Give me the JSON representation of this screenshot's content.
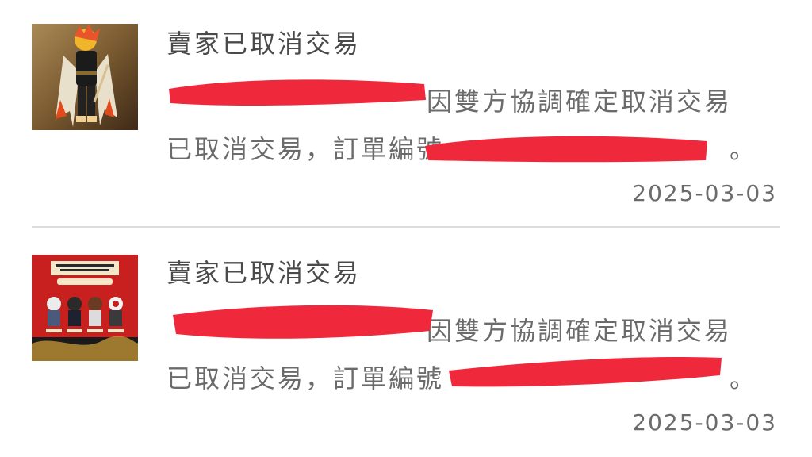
{
  "notifications": [
    {
      "title": "賣家已取消交易",
      "line1_text": "因雙方協調確定取消交易",
      "line2_text": "已取消交易，訂單編號",
      "line2_end": "。",
      "date": "2025-03-03",
      "thumbnail": "figure-product-photo"
    },
    {
      "title": "賣家已取消交易",
      "line1_text": "因雙方協調確定取消交易",
      "line2_text": "已取消交易，訂單編號",
      "line2_end": "。",
      "date": "2025-03-03",
      "thumbnail": "figure-set-product-box"
    }
  ],
  "colors": {
    "redaction": "#f0283c",
    "divider": "#dcdcdc",
    "title_text": "#4a4a4a",
    "body_text": "#6b6b6b"
  }
}
